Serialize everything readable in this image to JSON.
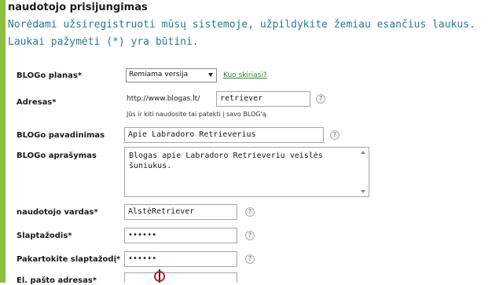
{
  "page": {
    "heading": "naudotojo prisijungimas",
    "intro_line1": "Norėdami užsiregistruoti mūsų sistemoje, užpildykite žemiau esančius laukus.",
    "intro_line2": "Laukai pažymėti (*) yra būtini."
  },
  "form": {
    "plan": {
      "label": "BLOGo planas*",
      "selected": "Remiama versija",
      "link": "Kuo skiriasi?"
    },
    "address": {
      "label": "Adresas*",
      "prefix": "http://www.blogas.lt/",
      "value": "retriever",
      "hint": "Jūs ir kiti naudosite tai patekti į savo BLOG'ą."
    },
    "blog_name": {
      "label": "BLOGo pavadinimas",
      "value": "Apie Labradoro Retrieverius"
    },
    "blog_description": {
      "label": "BLOGo aprašymas",
      "value": "Blogas apie Labradoro Retrieveriu veislės šuniukus."
    },
    "username": {
      "label": "naudotojo vardas*",
      "value": "AlstėRetriever"
    },
    "password": {
      "label": "Slaptažodis*",
      "value": "••••••"
    },
    "password_repeat": {
      "label": "Pakartokite slaptažodį*",
      "value": "••••••"
    },
    "email": {
      "label": "El. pašto adresas*",
      "value": ""
    },
    "help_glyph": "?"
  },
  "colors": {
    "accent_stripe": "#8fbe3f",
    "intro_text": "#2a7a96",
    "link": "#2b8a2b"
  },
  "icons": {
    "help": "question-circle-icon",
    "dropdown": "chevron-down-icon"
  }
}
